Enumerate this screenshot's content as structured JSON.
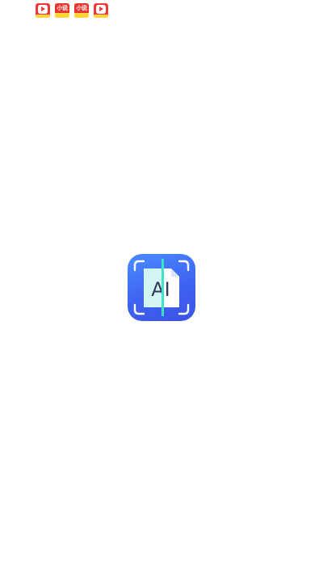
{
  "status_bar": {
    "notifications": [
      {
        "kind": "video-app-icon"
      },
      {
        "kind": "novel-app-icon",
        "label": "小说"
      },
      {
        "kind": "novel-app-icon",
        "label": "小说"
      },
      {
        "kind": "video-app-icon"
      }
    ]
  },
  "splash": {
    "logo_text": "AI",
    "logo_icon": "ai-document-scan-icon",
    "colors": {
      "logo_bg_start": "#4a8cff",
      "logo_bg_end": "#3a52e6",
      "scan_line": "#3fe0c8",
      "page": "#ffffff"
    }
  }
}
